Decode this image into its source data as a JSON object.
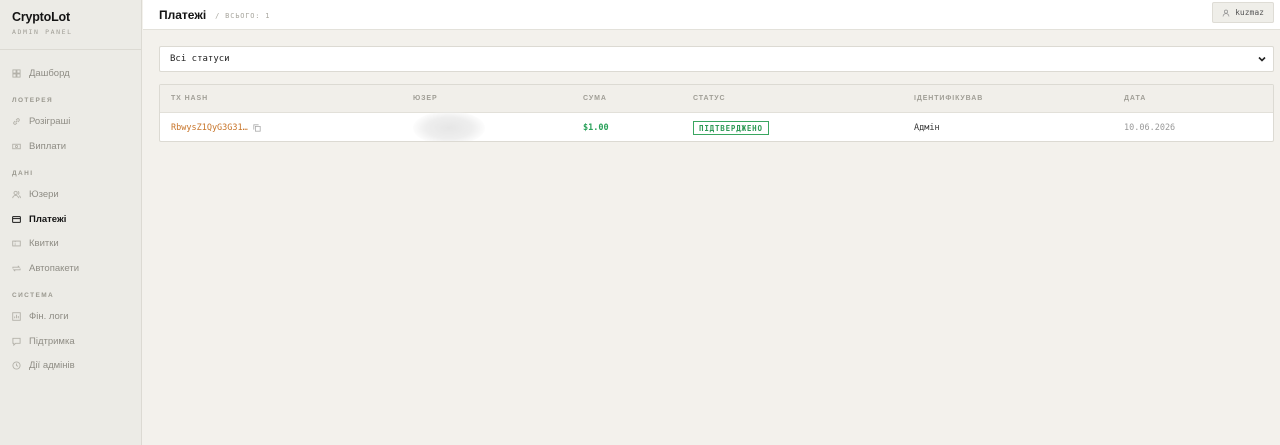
{
  "brand": {
    "title": "CryptoLot",
    "subtitle": "ADMIN PANEL"
  },
  "sidebar": {
    "top_item": {
      "label": "Дашборд",
      "icon": "dashboard-icon"
    },
    "groups": [
      {
        "title": "ЛОТЕРЕЯ",
        "items": [
          {
            "label": "Розіграші",
            "icon": "link-icon"
          },
          {
            "label": "Виплати",
            "icon": "payout-icon"
          }
        ]
      },
      {
        "title": "ДАНІ",
        "items": [
          {
            "label": "Юзери",
            "icon": "users-icon"
          },
          {
            "label": "Платежі",
            "icon": "card-icon",
            "active": true
          },
          {
            "label": "Квитки",
            "icon": "ticket-icon"
          },
          {
            "label": "Автопакети",
            "icon": "repeat-icon"
          }
        ]
      },
      {
        "title": "СИСТЕМА",
        "items": [
          {
            "label": "Фін. логи",
            "icon": "chart-icon"
          },
          {
            "label": "Підтримка",
            "icon": "chat-icon"
          },
          {
            "label": "Дії адмінів",
            "icon": "clock-icon"
          }
        ]
      }
    ]
  },
  "header": {
    "title": "Платежі",
    "count_text": "/ ВСЬОГО: 1",
    "user": "kuzmaz"
  },
  "filter": {
    "selected": "Всі статуси"
  },
  "table": {
    "columns": [
      "TX HASH",
      "ЮЗЕР",
      "СУМА",
      "СТАТУС",
      "ІДЕНТИФІКУВАВ",
      "ДАТА"
    ],
    "rows": [
      {
        "tx_hash": "RbwysZ1QyG3G31…",
        "user": "",
        "amount": "$1.00",
        "status": "ПІДТВЕРДЖЕНО",
        "identified_by": "Адмін",
        "date": "10.06.2026"
      }
    ]
  },
  "colors": {
    "accent_orange": "#c8752a",
    "success_green": "#2aa15a",
    "background": "#f3f1ec"
  }
}
